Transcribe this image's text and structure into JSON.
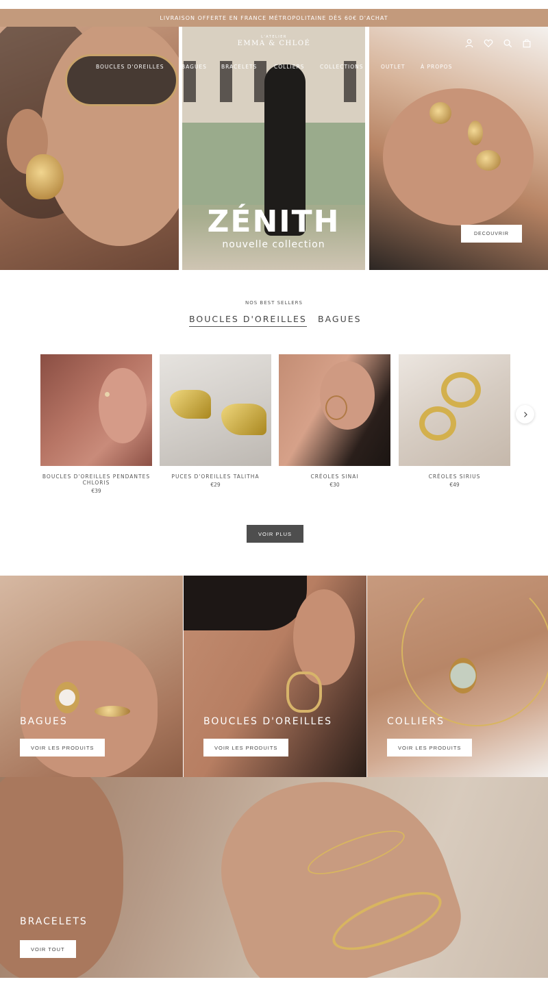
{
  "announcement": "LIVRAISON OFFERTE EN FRANCE MÉTROPOLITAINE DÈS 60€ D'ACHAT",
  "logo": {
    "small": "L'ATELIER",
    "main": "EMMA & CHLOÉ"
  },
  "nav": [
    "BOUCLES D'OREILLES",
    "BAGUES",
    "BRACELETS",
    "COLLIERS",
    "COLLECTIONS",
    "OUTLET",
    "À PROPOS"
  ],
  "header_icons": [
    "account-icon",
    "heart-icon",
    "search-icon",
    "bag-icon"
  ],
  "hero": {
    "title": "ZÉNITH",
    "subtitle": "nouvelle collection",
    "cta": "DECOUVRIR"
  },
  "best_sellers": {
    "kicker": "NOS BEST SELLERS",
    "tabs": [
      "BOUCLES D'OREILLES",
      "BAGUES"
    ],
    "products": [
      {
        "name": "BOUCLES D'OREILLES PENDANTES CHLORIS",
        "price": "€39"
      },
      {
        "name": "PUCES D'OREILLES TALITHA",
        "price": "€29"
      },
      {
        "name": "CRÉOLES SINAI",
        "price": "€30"
      },
      {
        "name": "CRÉOLES SIRIUS",
        "price": "€49"
      }
    ],
    "more": "VOIR PLUS"
  },
  "categories": [
    {
      "title": "BAGUES",
      "button": "VOIR LES PRODUITS"
    },
    {
      "title": "BOUCLES D'OREILLES",
      "button": "VOIR LES PRODUITS"
    },
    {
      "title": "COLLIERS",
      "button": "VOIR LES PRODUITS"
    }
  ],
  "bracelets": {
    "title": "BRACELETS",
    "button": "VOIR TOUT"
  },
  "colors": {
    "accent": "#c39a7c",
    "dark_button": "#4e4e4e",
    "white": "#ffffff"
  }
}
